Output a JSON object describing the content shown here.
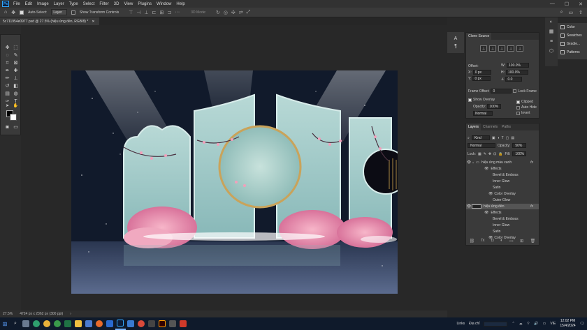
{
  "app": {
    "logo": "Ps"
  },
  "menubar": {
    "items": [
      "File",
      "Edit",
      "Image",
      "Layer",
      "Type",
      "Select",
      "Filter",
      "3D",
      "View",
      "Plugins",
      "Window",
      "Help"
    ],
    "controls": [
      "—",
      "☐",
      "✕"
    ]
  },
  "optionsbar": {
    "auto_select_label": "Auto-Select:",
    "auto_select_value": "Layer",
    "show_transform_label": "Show Transform Controls",
    "mode_3d_label": "3D Mode:"
  },
  "document": {
    "tab_title": "5c711954e0977.psd @ 27.5% (hiệu ứng đèn, RGB/8) *",
    "zoom": "27.5%",
    "dimensions": "4724 px x 2362 px (300 ppi)"
  },
  "clone_source": {
    "title": "Clone Source",
    "offset_label": "Offset:",
    "x_label": "X:",
    "x_value": "0 px",
    "y_label": "Y:",
    "y_value": "0 px",
    "w_label": "W:",
    "w_value": "100.0%",
    "h_label": "H:",
    "h_value": "100.0%",
    "angle_value": "0.0",
    "frame_offset_label": "Frame Offset:",
    "frame_offset_value": "0",
    "lock_frame_label": "Lock Frame",
    "show_overlay_label": "Show Overlay",
    "opacity_label": "Opacity:",
    "opacity_value": "100%",
    "blend_value": "Normal",
    "clipped_label": "Clipped",
    "auto_hide_label": "Auto Hide",
    "invert_label": "Invert"
  },
  "libraries": {
    "items": [
      {
        "label": "Color",
        "icon": "color-wheel-icon"
      },
      {
        "label": "Swatches",
        "icon": "swatches-icon"
      },
      {
        "label": "Gradie...",
        "icon": "gradients-icon"
      },
      {
        "label": "Patterns",
        "icon": "patterns-icon"
      }
    ]
  },
  "layers": {
    "tabs": [
      "Layers",
      "Channels",
      "Paths"
    ],
    "filter_value": "Kind",
    "blend_value": "Normal",
    "opacity_label": "Opacity:",
    "opacity_value": "50%",
    "lock_label": "Lock:",
    "fill_label": "Fill:",
    "fill_value": "100%",
    "rows": [
      {
        "label": "hiệu ứng màu xanh",
        "kind": "group",
        "fx": "fx"
      },
      {
        "label": "Effects",
        "kind": "effects"
      },
      {
        "label": "Bevel & Emboss",
        "kind": "effect"
      },
      {
        "label": "Inner Glow",
        "kind": "effect"
      },
      {
        "label": "Satin",
        "kind": "effect"
      },
      {
        "label": "Color Overlay",
        "kind": "effect"
      },
      {
        "label": "Outer Glow",
        "kind": "effect"
      },
      {
        "label": "hiệu ứng đèn",
        "kind": "layer",
        "fx": "fx",
        "selected": true
      },
      {
        "label": "Effects",
        "kind": "effects"
      },
      {
        "label": "Bevel & Emboss",
        "kind": "effect"
      },
      {
        "label": "Inner Glow",
        "kind": "effect"
      },
      {
        "label": "Satin",
        "kind": "effect"
      },
      {
        "label": "Color Overlay",
        "kind": "effect"
      }
    ]
  },
  "taskbar": {
    "tray_links": "Links",
    "tray_address": "Địa chỉ",
    "language": "VIE",
    "time": "12:02 PM",
    "date": "15/4/2024"
  }
}
